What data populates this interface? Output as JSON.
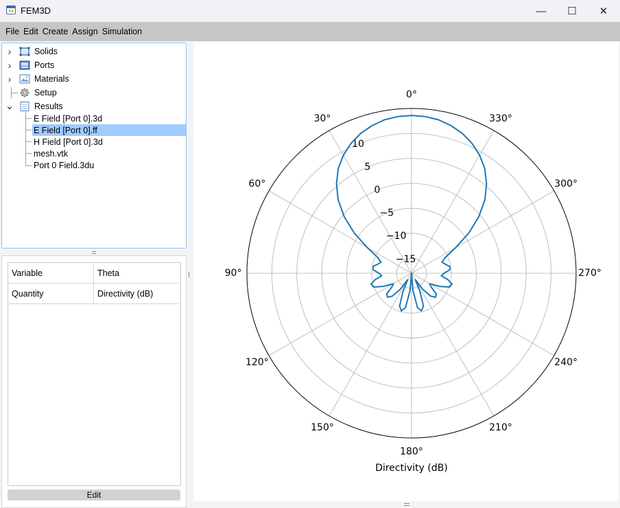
{
  "window": {
    "title": "FEM3D",
    "minimize_glyph": "—",
    "maximize_glyph": "☐",
    "close_glyph": "✕"
  },
  "menu": [
    "File",
    "Edit",
    "Create",
    "Assign",
    "Simulation"
  ],
  "tree": {
    "nodes": [
      {
        "label": "Solids",
        "icon": "solids-icon",
        "chevron": "›"
      },
      {
        "label": "Ports",
        "icon": "ports-icon",
        "chevron": "›"
      },
      {
        "label": "Materials",
        "icon": "materials-icon",
        "chevron": "›"
      },
      {
        "label": "Setup",
        "icon": "gear-icon",
        "chevron": ""
      },
      {
        "label": "Results",
        "icon": "results-icon",
        "chevron": "⌄"
      }
    ],
    "results_children": [
      "E Field [Port 0].3d",
      "E Field [Port 0].ff",
      "H Field [Port 0].3d",
      "mesh.vtk",
      "Port 0 Field.3du"
    ],
    "selected_child": "E Field [Port 0].ff"
  },
  "properties": {
    "rows": [
      {
        "key": "Variable",
        "value": "Theta"
      },
      {
        "key": "Quantity",
        "value": "Directivity (dB)"
      }
    ],
    "edit_label": "Edit"
  },
  "chart_data": {
    "type": "polar line",
    "title": "",
    "xlabel": "Directivity (dB)",
    "theta_zero_location": "top",
    "theta_direction": "counterclockwise",
    "r_ticks": [
      -15,
      -10,
      -5,
      0,
      5,
      10
    ],
    "r_range": [
      -18,
      15
    ],
    "theta_ticks": [
      "0°",
      "30°",
      "60°",
      "90°",
      "120°",
      "150°",
      "180°",
      "210°",
      "240°",
      "270°",
      "300°",
      "330°"
    ],
    "grid": true,
    "line_color": "#1f77b4",
    "series": [
      {
        "theta_deg": [
          0,
          5,
          10,
          15,
          20,
          25,
          30,
          35,
          40,
          45,
          50,
          55,
          60,
          65,
          70,
          75,
          80,
          85,
          90,
          95,
          100,
          105,
          110,
          115,
          120,
          125,
          130,
          135,
          140,
          145,
          150,
          155,
          160,
          165,
          170,
          175,
          180,
          185,
          190,
          195,
          200,
          205,
          210,
          215,
          220,
          225,
          230,
          235,
          240,
          245,
          250,
          255,
          260,
          265,
          270,
          275,
          280,
          285,
          290,
          295,
          300,
          305,
          310,
          315,
          320,
          325,
          330,
          335,
          340,
          345,
          350,
          355,
          360
        ],
        "r": [
          13.6,
          13.5,
          13.2,
          12.6,
          11.8,
          10.7,
          9.3,
          7.6,
          5.4,
          2.8,
          -0.4,
          -4.0,
          -7.8,
          -10.5,
          -11.5,
          -11.0,
          -10.2,
          -10.3,
          -11.5,
          -12.0,
          -10.6,
          -9.6,
          -9.9,
          -11.8,
          -13.8,
          -13.2,
          -11.5,
          -11.2,
          -12.0,
          -14.0,
          -16.5,
          -14.0,
          -11.0,
          -10.2,
          -11.0,
          -14.5,
          -18.0,
          -14.5,
          -11.0,
          -10.2,
          -11.0,
          -14.0,
          -16.5,
          -14.0,
          -12.0,
          -11.2,
          -11.5,
          -13.2,
          -13.8,
          -11.8,
          -9.9,
          -9.6,
          -10.6,
          -12.0,
          -11.5,
          -10.3,
          -10.2,
          -11.0,
          -11.5,
          -10.5,
          -7.8,
          -4.0,
          -0.4,
          2.8,
          5.4,
          7.6,
          9.3,
          10.7,
          11.8,
          12.6,
          13.2,
          13.5,
          13.6
        ]
      }
    ]
  }
}
